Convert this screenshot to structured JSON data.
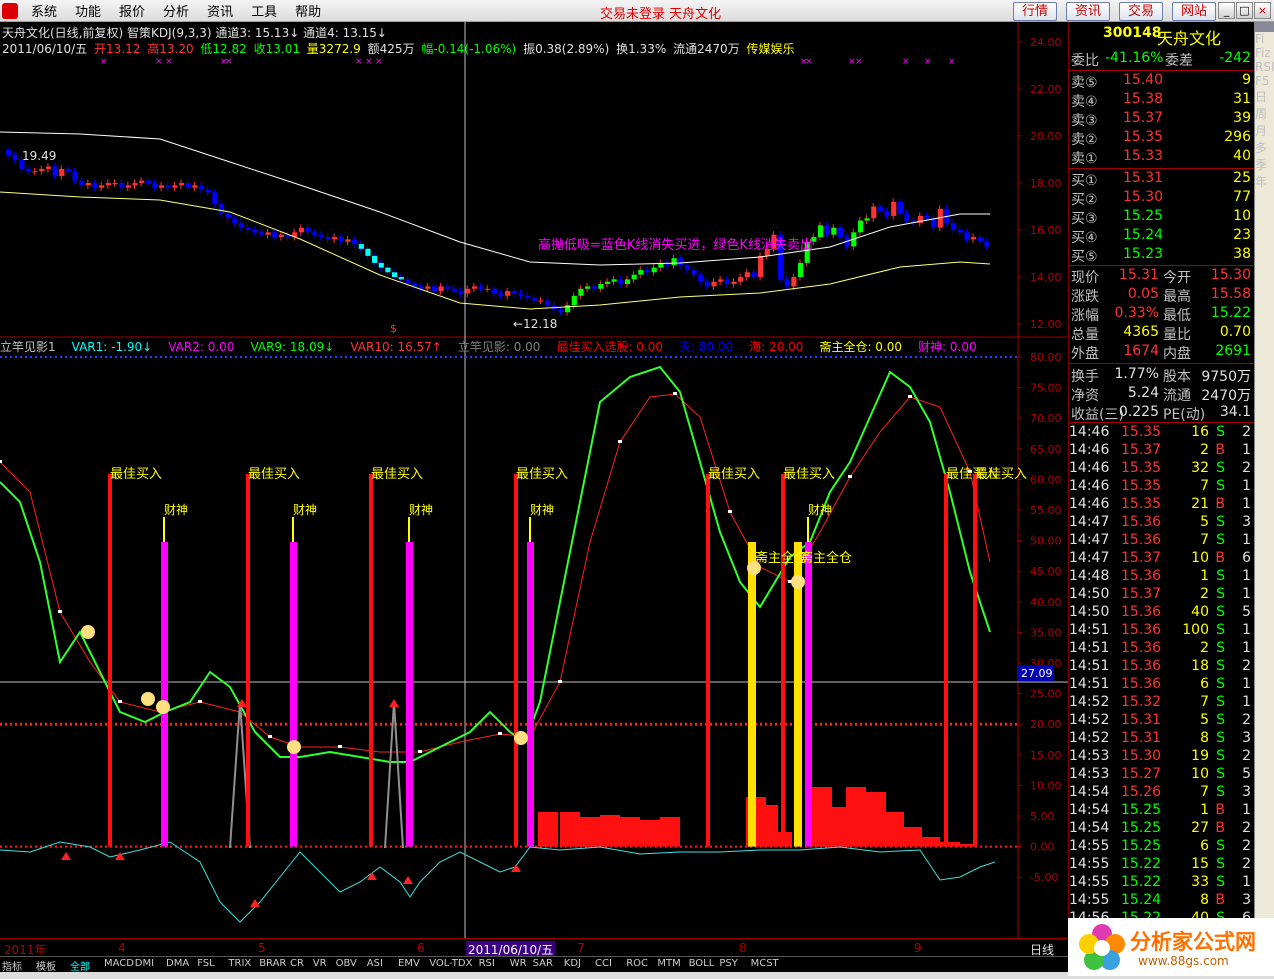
{
  "menu": {
    "items": [
      "系统",
      "功能",
      "报价",
      "分析",
      "资讯",
      "工具",
      "帮助"
    ],
    "center_status": "交易未登录  天舟文化",
    "buttons": [
      "行情",
      "资讯",
      "交易",
      "网站"
    ],
    "win": [
      "_",
      "□",
      "×"
    ]
  },
  "colors": {
    "up": "#ff3232",
    "down": "#0000ff",
    "bg": "#000000",
    "axis": "#b00000",
    "yellow": "#ffff00",
    "green": "#00ff00",
    "magenta": "#ff00ff",
    "cyan": "#00ffff"
  },
  "kchart": {
    "title_line": "天舟文化(日线,前复权) 智策KDJ(9,3,3) 通道3: 15.13↓ 通道4: 13.15↓",
    "info_line": {
      "date": "2011/06/10/五",
      "open": "开13.12",
      "high": "高13.20",
      "low": "低12.82",
      "close": "收13.01",
      "vol": "量3272.9",
      "amt": "额425万",
      "chg": "幅-0.14(-1.06%)",
      "amp": "振0.38(2.89%)",
      "turn": "换1.33%",
      "float": "流通2470万",
      "sector": "传媒娱乐"
    },
    "y_ticks": [
      "24.00",
      "22.00",
      "20.00",
      "18.00",
      "16.00",
      "14.00",
      "12.00"
    ],
    "annotation": "高抛低吸=蓝色K线消失买进，绿色K线消失卖出",
    "high_label": "19.49",
    "low_label": "←12.18",
    "marker": "$"
  },
  "indicator": {
    "legend": [
      {
        "t": "立竿见影1",
        "c": "#c0c0c0"
      },
      {
        "t": "VAR1: -1.90↓",
        "c": "#00ffff"
      },
      {
        "t": "VAR2: 0.00",
        "c": "#ff00ff"
      },
      {
        "t": "VAR9: 18.09↓",
        "c": "#00ff00"
      },
      {
        "t": "VAR10: 16.57↑",
        "c": "#ff3232"
      },
      {
        "t": "立竿见影: 0.00",
        "c": "#808080"
      },
      {
        "t": "最佳买入选股: 0.00",
        "c": "#ff0000"
      },
      {
        "t": "天: 80.00",
        "c": "#0000ff"
      },
      {
        "t": "海: 20.00",
        "c": "#ff0000"
      },
      {
        "t": "斋主全仓: 0.00",
        "c": "#ffff00"
      },
      {
        "t": "财神: 0.00",
        "c": "#ff00ff"
      }
    ],
    "y_ticks": [
      "80.00",
      "75.00",
      "70.00",
      "65.00",
      "60.00",
      "55.00",
      "50.00",
      "45.00",
      "40.00",
      "35.00",
      "30.00",
      "25.00",
      "20.00",
      "15.00",
      "10.00",
      "5.00",
      "0.00",
      "-5.00"
    ],
    "cursor_value": "27.09",
    "buy_label": "最佳买入",
    "god_label": "财神",
    "zhai_label": "斋主全仓"
  },
  "time_axis": {
    "labels": [
      "2011年",
      "4",
      "5",
      "6",
      "2011/06/10/五",
      "7",
      "8",
      "9"
    ],
    "period": "日线"
  },
  "tabs": [
    "指标",
    "模板",
    "全部",
    "MACD",
    "DMI",
    "DMA",
    "FSL",
    "TRIX",
    "BRAR",
    "CR",
    "VR",
    "OBV",
    "ASI",
    "EMV",
    "VOL-TDX",
    "RSI",
    "WR",
    "SAR",
    "KDJ",
    "CCI",
    "ROC",
    "MTM",
    "BOLL",
    "PSY",
    "MCST"
  ],
  "quote": {
    "code": "300148",
    "name": "天舟文化",
    "weibi_label": "委比",
    "weibi": "-41.16%",
    "weicha_label": "委差",
    "weicha": "-242",
    "sell": [
      {
        "l": "卖⑤",
        "p": "15.40",
        "v": "9"
      },
      {
        "l": "卖④",
        "p": "15.38",
        "v": "31"
      },
      {
        "l": "卖③",
        "p": "15.37",
        "v": "39"
      },
      {
        "l": "卖②",
        "p": "15.35",
        "v": "296"
      },
      {
        "l": "卖①",
        "p": "15.33",
        "v": "40"
      }
    ],
    "buy": [
      {
        "l": "买①",
        "p": "15.31",
        "v": "25"
      },
      {
        "l": "买②",
        "p": "15.30",
        "v": "77"
      },
      {
        "l": "买③",
        "p": "15.25",
        "v": "10"
      },
      {
        "l": "买④",
        "p": "15.24",
        "v": "23"
      },
      {
        "l": "买⑤",
        "p": "15.23",
        "v": "38"
      }
    ],
    "stats": [
      {
        "a": "现价",
        "b": "15.31",
        "c": "今开",
        "d": "15.30"
      },
      {
        "a": "涨跌",
        "b": "0.05",
        "c": "最高",
        "d": "15.58"
      },
      {
        "a": "涨幅",
        "b": "0.33%",
        "c": "最低",
        "d": "15.22"
      },
      {
        "a": "总量",
        "b": "4365",
        "c": "量比",
        "d": "0.70"
      },
      {
        "a": "外盘",
        "b": "1674",
        "c": "内盘",
        "d": "2691"
      },
      {
        "a": "换手",
        "b": "1.77%",
        "c": "股本",
        "d": "9750万"
      },
      {
        "a": "净资",
        "b": "5.24",
        "c": "流通",
        "d": "2470万"
      },
      {
        "a": "收益(三)",
        "b": "0.225",
        "c": "PE(动)",
        "d": "34.1"
      }
    ],
    "ticks": [
      [
        "14:46",
        "15.35",
        "16",
        "S",
        "2"
      ],
      [
        "14:46",
        "15.37",
        "2",
        "B",
        "1"
      ],
      [
        "14:46",
        "15.35",
        "32",
        "S",
        "2"
      ],
      [
        "14:46",
        "15.35",
        "7",
        "S",
        "1"
      ],
      [
        "14:46",
        "15.35",
        "21",
        "B",
        "1"
      ],
      [
        "14:47",
        "15.36",
        "5",
        "S",
        "3"
      ],
      [
        "14:47",
        "15.36",
        "7",
        "S",
        "1"
      ],
      [
        "14:47",
        "15.37",
        "10",
        "B",
        "6"
      ],
      [
        "14:48",
        "15.36",
        "1",
        "S",
        "1"
      ],
      [
        "14:50",
        "15.37",
        "2",
        "S",
        "1"
      ],
      [
        "14:50",
        "15.36",
        "40",
        "S",
        "5"
      ],
      [
        "14:51",
        "15.36",
        "100",
        "S",
        "1"
      ],
      [
        "14:51",
        "15.36",
        "2",
        "S",
        "1"
      ],
      [
        "14:51",
        "15.36",
        "18",
        "S",
        "2"
      ],
      [
        "14:51",
        "15.36",
        "6",
        "S",
        "1"
      ],
      [
        "14:52",
        "15.32",
        "7",
        "S",
        "1"
      ],
      [
        "14:52",
        "15.31",
        "5",
        "S",
        "2"
      ],
      [
        "14:52",
        "15.31",
        "8",
        "S",
        "3"
      ],
      [
        "14:53",
        "15.30",
        "19",
        "S",
        "2"
      ],
      [
        "14:53",
        "15.27",
        "10",
        "S",
        "5"
      ],
      [
        "14:54",
        "15.26",
        "7",
        "S",
        "3"
      ],
      [
        "14:54",
        "15.25",
        "1",
        "B",
        "1"
      ],
      [
        "14:54",
        "15.25",
        "27",
        "B",
        "2"
      ],
      [
        "14:55",
        "15.25",
        "6",
        "S",
        "2"
      ],
      [
        "14:55",
        "15.22",
        "15",
        "S",
        "2"
      ],
      [
        "14:55",
        "15.22",
        "33",
        "S",
        "1"
      ],
      [
        "14:55",
        "15.24",
        "8",
        "B",
        "3"
      ],
      [
        "14:56",
        "15.22",
        "40",
        "S",
        "6"
      ]
    ]
  },
  "tools": [
    "Fi",
    "Fiz",
    "RSI",
    "F5",
    "日",
    "周",
    "月",
    "多",
    "季",
    "年"
  ],
  "logo": {
    "text": "分析家公式网",
    "url": "www.88gs.com"
  }
}
